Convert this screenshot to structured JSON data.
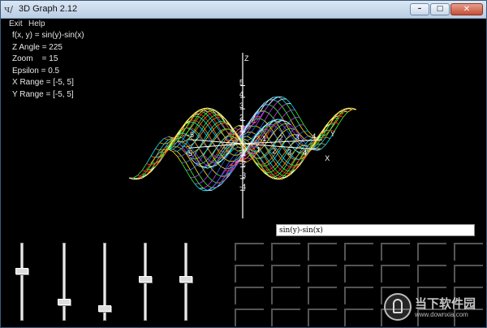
{
  "window": {
    "title": "3D Graph 2.12",
    "icon_glyph": "ч/"
  },
  "window_buttons": {
    "minimize": "–",
    "maximize": "□",
    "close": "✕"
  },
  "menu": {
    "items": [
      "Exit",
      "Help"
    ]
  },
  "info": {
    "function": "f(x, y) = sin(y)-sin(x)",
    "z_angle": "Z Angle = 225",
    "zoom": "Zoom    = 15",
    "epsilon": "Epsilon = 0.5",
    "x_range": "X Range = [-5, 5]",
    "y_range": "Y Range = [-5, 5]"
  },
  "axis_labels": {
    "z": "Z",
    "x": "X",
    "y": "Y",
    "z_ticks": [
      "5",
      "4",
      "3",
      "2",
      "1",
      "-1",
      "-2",
      "-3",
      "-4"
    ],
    "x_ticks": [
      "1",
      "2",
      "3",
      "4"
    ],
    "y_ticks": [
      "1",
      "2",
      "3",
      "4"
    ],
    "neg_ticks": [
      "-5",
      "-5"
    ]
  },
  "function_input": {
    "value": "sin(y)-sin(x)"
  },
  "sliders": [
    {
      "name": "slider-1",
      "level": 0.35
    },
    {
      "name": "slider-2",
      "level": 0.78
    },
    {
      "name": "slider-3",
      "level": 0.88
    },
    {
      "name": "slider-4",
      "level": 0.47
    },
    {
      "name": "slider-5",
      "level": 0.47
    }
  ],
  "watermark": {
    "text": "当下软件园",
    "url": "www.downxia.com"
  },
  "colors": {
    "background": "#000000",
    "surface_palette": [
      "#ffffff",
      "#ff3030",
      "#ff9900",
      "#ffee00",
      "#33ff33",
      "#00e5ff",
      "#3366ff",
      "#cc33ff"
    ]
  }
}
